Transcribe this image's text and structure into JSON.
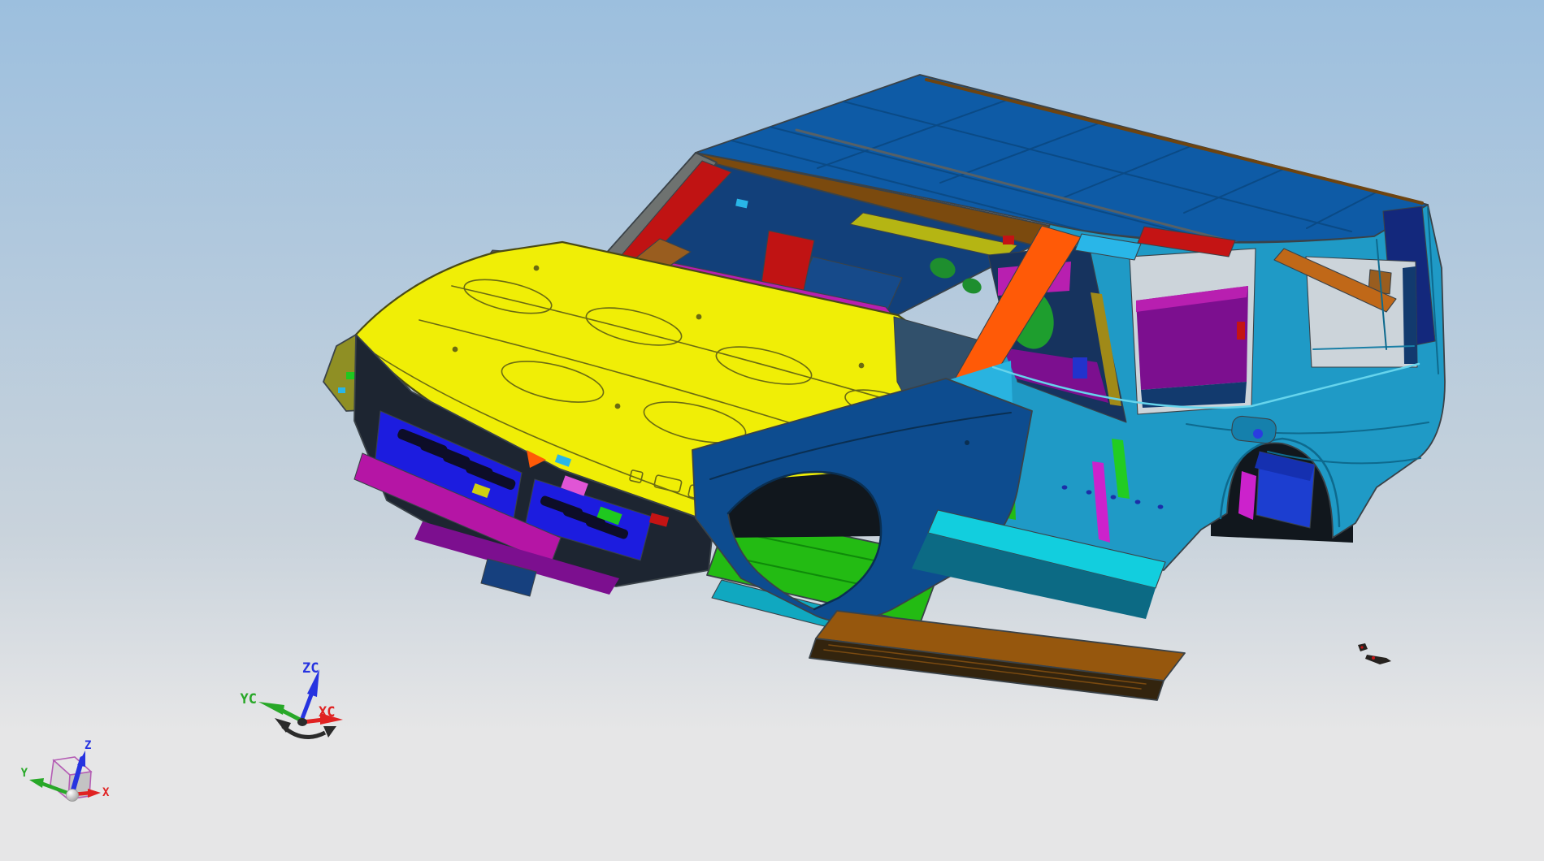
{
  "viewport": {
    "background_top": "#9cbfde",
    "background_mid": "#c9d3dc",
    "background_bottom": "#e6e6e7"
  },
  "wcs_triad": {
    "z": {
      "label": "ZC",
      "color": "#2633e0"
    },
    "y": {
      "label": "YC",
      "color": "#28a828"
    },
    "x": {
      "label": "XC",
      "color": "#e02222"
    },
    "handle_color": "#2b2b2b"
  },
  "nav_cube": {
    "z": {
      "label": "Z",
      "color": "#2633e0"
    },
    "y": {
      "label": "Y",
      "color": "#28a828"
    },
    "x": {
      "label": "X",
      "color": "#e02222"
    },
    "face_color": "#d9d9d9",
    "face_dark": "#c3c3c3",
    "face_light": "#e6e6e6",
    "edge_color": "#b45cb4",
    "origin_sphere": "#f2f2f2"
  },
  "model": {
    "description": "SUV body-in-white, multicolor component display",
    "parts": {
      "roof_panel": {
        "color": "#0e5ba6"
      },
      "roof_far_rail": {
        "color": "#6e4410"
      },
      "windshield_header": {
        "color": "#7b4a0e"
      },
      "a_pillar": {
        "color": "#6e7270"
      },
      "a_pillar_inner": {
        "color": "#c01313"
      },
      "a_pillar_lower": {
        "color": "#995d1f"
      },
      "windshield_interior": {
        "color": "#12407a"
      },
      "header_inner_yellow": {
        "color": "#b5b513"
      },
      "interior_panel_blue": {
        "color": "#164a8a"
      },
      "interior_red": {
        "color": "#c01313"
      },
      "cowl_magenta": {
        "color": "#b81fb0"
      },
      "cowl_purple": {
        "color": "#8a12a0"
      },
      "interior_green": {
        "color": "#1e8e2e"
      },
      "cowl_far_strip": {
        "color": "#55524a"
      },
      "cowl_side_olive": {
        "color": "#8f8f24"
      },
      "hood": {
        "color": "#f0ee06"
      },
      "engine_bay": {
        "color": "#1d2531"
      },
      "radiator_support": {
        "color": "#1c1cdf"
      },
      "front_crossbar": {
        "color": "#b515a5"
      },
      "front_lower_bar": {
        "color": "#7c0f8f"
      },
      "front_chin": {
        "color": "#16407e"
      },
      "front_floor_green": {
        "color": "#23bb13"
      },
      "under_floor_cyan": {
        "color": "#10a8c0"
      },
      "arch_cavity": {
        "color": "#11171d"
      },
      "front_fender": {
        "color": "#0d4c8f"
      },
      "cowl_wedge": {
        "color": "#31506b"
      },
      "body_side": {
        "color": "#1f9ac6"
      },
      "d_pillar_navy": {
        "color": "#13287c"
      },
      "window_opening": {
        "color": "#ccd4da"
      },
      "front_window_interior": {
        "color": "#16335e"
      },
      "wheelhouse_green": {
        "color": "#1e9e2e"
      },
      "seatback_purple": {
        "color": "#7c0f8f"
      },
      "seatback_magenta": {
        "color": "#b81fb0"
      },
      "window_navy": {
        "color": "#123a6e"
      },
      "quarter_bracket_brown": {
        "color": "#995d1f"
      },
      "quarter_rail_brown": {
        "color": "#c06818"
      },
      "b_pillar_orange": {
        "color": "#ff5a07"
      },
      "rail_cyan": {
        "color": "#29b6e8"
      },
      "rail_red": {
        "color": "#c41414"
      },
      "door_dash_cyan": {
        "color": "#29b3e0"
      },
      "cabin_floor_brown": {
        "color": "#8a5212"
      },
      "door_floor_green": {
        "color": "#23bb13"
      },
      "pillar_strip_olive": {
        "color": "#a08a18"
      },
      "pillar_strip_green": {
        "color": "#22cc22"
      },
      "pillar_strip_magenta": {
        "color": "#cc22cc"
      },
      "pillar_blue_box": {
        "color": "#2233cc"
      },
      "spring_housing": {
        "color": "#1c3ed0"
      },
      "spring_housing_top": {
        "color": "#1530b0"
      },
      "arch_magenta": {
        "color": "#cc22cc"
      },
      "sill_cyan": {
        "color": "#12cede"
      },
      "sill_shadow": {
        "color": "#0c6a84"
      },
      "rocker_top": {
        "color": "#96570d"
      },
      "rocker_side": {
        "color": "#33240e"
      },
      "handle_pocket": {
        "color": "#1580ac"
      },
      "handle_dot": {
        "color": "#2a3de0"
      },
      "weld_dot": {
        "color": "#1b2fa8"
      },
      "debris": {
        "color": "#26221f"
      },
      "accent_orange": {
        "color": "#ff5a07"
      },
      "accent_pink": {
        "color": "#e055d5"
      },
      "accent_green": {
        "color": "#1fc81f"
      },
      "accent_cyan": {
        "color": "#29b6e8"
      },
      "accent_red": {
        "color": "#c41414"
      },
      "accent_yellow": {
        "color": "#cfcf10"
      }
    }
  }
}
